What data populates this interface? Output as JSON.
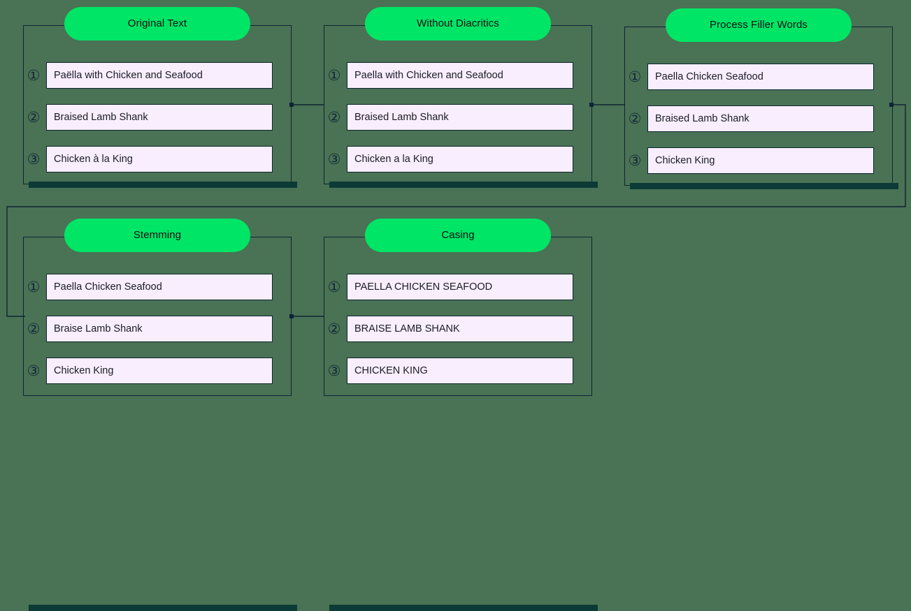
{
  "theme": {
    "background": "#4a7254",
    "pill_green": "#00e566",
    "line_dark": "#0d2535",
    "item_fill": "#f8eefd",
    "shadow_bar": "#0c3a36",
    "title_text": "#0a0f14",
    "item_text": "#1b1b26"
  },
  "diagram": {
    "type": "pipeline-stages",
    "badge_glyphs": [
      "①",
      "②",
      "③"
    ],
    "cards": [
      {
        "id": "original-text",
        "title": "Original Text",
        "items": [
          "Paëlla with Chicken and Seafood",
          "Braised Lamb Shank",
          "Chicken à la King"
        ]
      },
      {
        "id": "without-diacritics",
        "title": "Without Diacritics",
        "items": [
          "Paella with Chicken and Seafood",
          "Braised Lamb Shank",
          "Chicken a la King"
        ]
      },
      {
        "id": "process-filler-words",
        "title": "Process Filler Words",
        "items": [
          "Paella Chicken Seafood",
          "Braised Lamb Shank",
          "Chicken King"
        ]
      },
      {
        "id": "stemming",
        "title": "Stemming",
        "items": [
          "Paella Chicken Seafood",
          "Braise Lamb Shank",
          "Chicken King"
        ]
      },
      {
        "id": "casing",
        "title": "Casing",
        "items": [
          "PAELLA CHICKEN SEAFOOD",
          "BRAISE LAMB SHANK",
          "CHICKEN KING"
        ]
      }
    ]
  }
}
